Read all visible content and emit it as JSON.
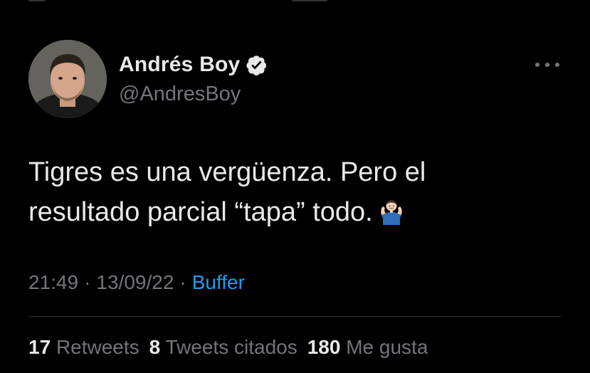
{
  "tweet": {
    "author": {
      "display_name": "Andrés Boy",
      "handle": "@AndresBoy",
      "verified": true
    },
    "text_line1": "Tigres es una vergüenza. Pero el",
    "text_line2": "resultado parcial “tapa” todo.",
    "emoji": "man-shrugging-emoji",
    "time": "21:49",
    "date": "13/09/22",
    "separator": "·",
    "source": "Buffer",
    "stats": {
      "retweets_count": "17",
      "retweets_label": "Retweets",
      "quotes_count": "8",
      "quotes_label": "Tweets citados",
      "likes_count": "180",
      "likes_label": "Me gusta"
    }
  },
  "colors": {
    "background": "#000000",
    "primary_text": "#e7e9ea",
    "secondary_text": "#71767b",
    "link": "#1d9bf0",
    "divider": "#2f3336"
  }
}
